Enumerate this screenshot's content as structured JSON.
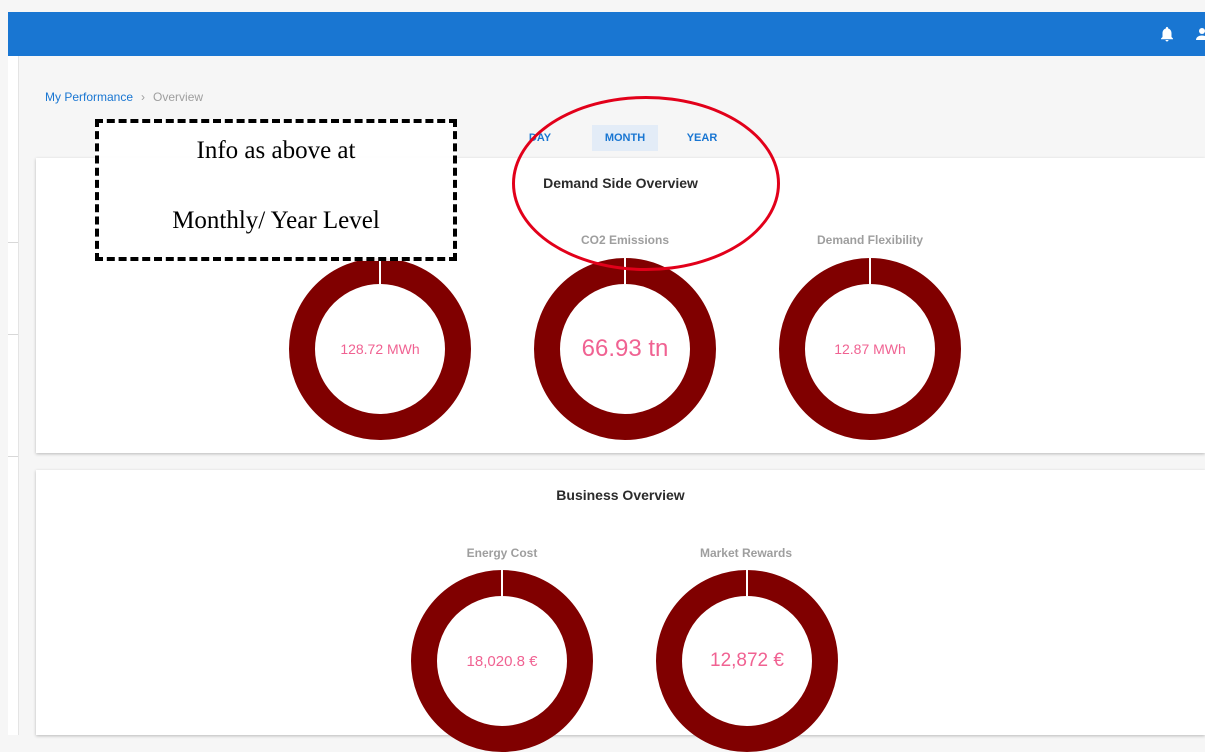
{
  "header": {
    "bell_icon": "bell-icon",
    "user_icon": "user-icon"
  },
  "breadcrumb": {
    "parent": "My Performance",
    "separator": "›",
    "current": "Overview"
  },
  "period_toggle": {
    "options": [
      "DAY",
      "MONTH",
      "YEAR"
    ],
    "selected": "MONTH"
  },
  "demand_card": {
    "title": "Demand Side Overview",
    "metrics": [
      {
        "label": "",
        "value": "128.72 MWh"
      },
      {
        "label": "CO2 Emissions",
        "value": "66.93 tn"
      },
      {
        "label": "Demand Flexibility",
        "value": "12.87 MWh"
      }
    ]
  },
  "business_card": {
    "title": "Business Overview",
    "metrics": [
      {
        "label": "Energy Cost",
        "value": "18,020.8 €"
      },
      {
        "label": "Market Rewards",
        "value": "12,872 €"
      }
    ]
  },
  "annotation": {
    "line1": "Info as above at",
    "line2": "Monthly/ Year Level"
  },
  "colors": {
    "header": "#1976d2",
    "donut_ring": "#800000",
    "donut_value": "#f06292",
    "annotation_ellipse": "#e2001a"
  }
}
